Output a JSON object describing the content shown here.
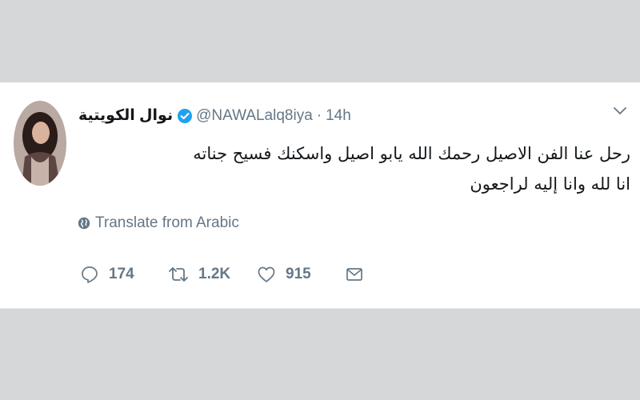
{
  "tweet": {
    "author": {
      "name": "نوال الكويتية",
      "handle": "@NAWALalq8iya",
      "verified": true
    },
    "separator": "·",
    "time": "14h",
    "lines": [
      "رحل عنا الفن الاصيل رحمك الله يابو اصيل واسكنك فسيح جناته",
      "انا لله وانا إليه لراجعون"
    ],
    "translate_label": "Translate from Arabic",
    "actions": {
      "reply_count": "174",
      "retweet_count": "1.2K",
      "like_count": "915"
    }
  },
  "colors": {
    "background": "#d6d7d9",
    "card": "#ffffff",
    "text": "#14171a",
    "muted": "#657786",
    "verified": "#1da1f2"
  }
}
